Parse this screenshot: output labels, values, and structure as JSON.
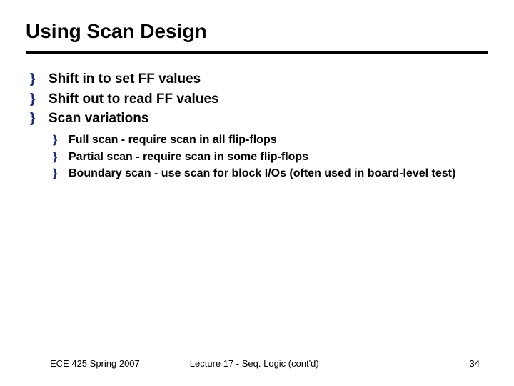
{
  "title": "Using Scan Design",
  "bullets": [
    {
      "text": "Shift in to set FF values"
    },
    {
      "text": "Shift out to read FF values"
    },
    {
      "text": "Scan variations"
    }
  ],
  "sub_bullets": [
    {
      "text": "Full scan - require scan in all flip-flops"
    },
    {
      "text": "Partial scan - require scan in some flip-flops"
    },
    {
      "text": "Boundary scan - use scan for block I/Os (often used in board-level test)"
    }
  ],
  "footer": {
    "left": "ECE 425 Spring 2007",
    "center": "Lecture 17 - Seq. Logic (cont'd)",
    "right": "34"
  }
}
